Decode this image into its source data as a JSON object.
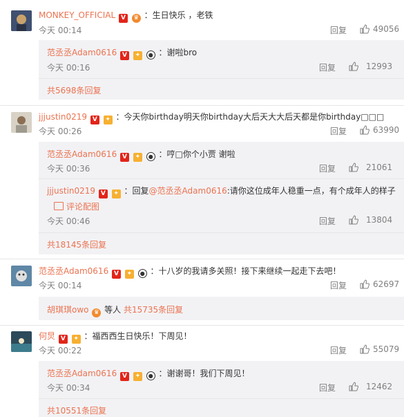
{
  "comments": [
    {
      "user": "MONKEY_OFFICIAL",
      "text": "：生日快乐 ，老铁",
      "time": "今天 00:14",
      "reply_label": "回复",
      "likes": "49056",
      "replies": [
        {
          "user": "范丞丞Adam0616",
          "text": "：谢啦bro",
          "time": "今天 00:16",
          "reply_label": "回复",
          "likes": "12993"
        }
      ],
      "more": "共5698条回复"
    },
    {
      "user": "jjjustin0219",
      "text": "：今天你birthday明天你birthday大后天大大后天都是你birthday□□□",
      "time": "今天 00:26",
      "reply_label": "回复",
      "likes": "63990",
      "replies": [
        {
          "user": "范丞丞Adam0616",
          "text": "：哼□你个小贾 谢啦",
          "time": "今天 00:36",
          "reply_label": "回复",
          "likes": "21061"
        },
        {
          "user": "jjjustin0219",
          "text_prefix": "：回复",
          "mention": "@范丞丞Adam0616",
          "text": ":请你这位成年人稳重一点，有个成年人的样子",
          "pic_label": "评论配图",
          "time": "今天 00:46",
          "reply_label": "回复",
          "likes": "13804"
        }
      ],
      "more": "共18145条回复"
    },
    {
      "user": "范丞丞Adam0616",
      "text": "：十八岁的我请多关照！接下来继续一起走下去吧！",
      "time": "今天 00:14",
      "reply_label": "回复",
      "likes": "62697",
      "more_user": "胡琪琪owo",
      "more_mid": "等人",
      "more": "共15735条回复"
    },
    {
      "user": "何炅",
      "text": "：福西西生日快乐！下周见！",
      "time": "今天 00:22",
      "reply_label": "回复",
      "likes": "55079",
      "replies": [
        {
          "user": "范丞丞Adam0616",
          "text": "：谢谢哥！我们下周见！",
          "time": "今天 00:34",
          "reply_label": "回复",
          "likes": "12462"
        }
      ],
      "more": "共10551条回复"
    }
  ],
  "icons": {
    "verified": "verified-v-icon",
    "vip": "vip-badge-icon",
    "panda": "panda-badge-icon",
    "like": "thumbs-up-icon",
    "picture": "image-icon"
  },
  "colors": {
    "accent": "#eb7350",
    "muted": "#808080",
    "sub_background": "#f2f2f5",
    "verified": "#e2251a"
  }
}
